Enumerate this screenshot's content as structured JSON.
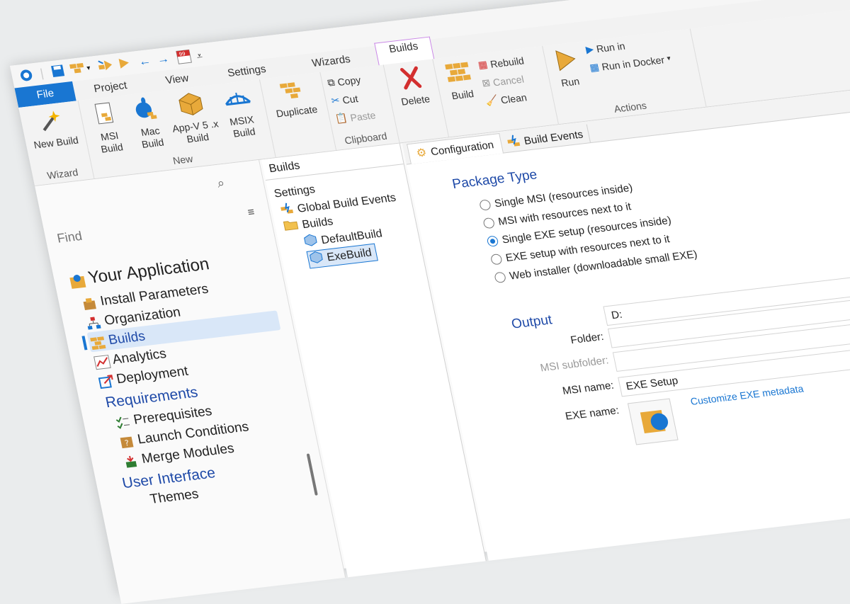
{
  "quick_access": {
    "icons": [
      "app-logo-icon",
      "save-icon",
      "build-bricks-icon",
      "dropdown-icon",
      "build-run-icon",
      "run-arrow-icon",
      "back-arrow-icon",
      "forward-arrow-icon",
      "tasks-icon",
      "more-icon"
    ],
    "badge": "99"
  },
  "tabs": {
    "file": "File",
    "project": "Project",
    "view": "View",
    "settings": "Settings",
    "wizards": "Wizards",
    "builds": "Builds"
  },
  "ribbon": {
    "wizard_group": {
      "label": "Wizard",
      "new_build": "New Build"
    },
    "new_group": {
      "label": "New",
      "msi_build": "MSI Build",
      "mac_build": "Mac Build",
      "appv_build": "App-V 5 .x Build",
      "msix_build": "MSIX Build"
    },
    "duplicate": "Duplicate",
    "clipboard_group": {
      "label": "Clipboard",
      "copy": "Copy",
      "cut": "Cut",
      "paste": "Paste"
    },
    "delete": "Delete",
    "build_group": {
      "build": "Build",
      "rebuild": "Rebuild",
      "cancel": "Cancel",
      "clean": "Clean"
    },
    "actions_group": {
      "label": "Actions",
      "run": "Run",
      "run_in": "Run in",
      "run_in_docker": "Run in Docker"
    }
  },
  "left_pane": {
    "search_placeholder": "Find",
    "app_title": "Your Application",
    "items": [
      "Install Parameters",
      "Organization",
      "Builds",
      "Analytics",
      "Deployment"
    ],
    "requirements_title": "Requirements",
    "requirements_items": [
      "Prerequisites",
      "Launch Conditions",
      "Merge Modules"
    ],
    "ui_title": "User Interface",
    "ui_partial": "Themes"
  },
  "mid_pane": {
    "header": "Builds",
    "settings_label": "Settings",
    "global_build_events": "Global Build Events",
    "builds_folder": "Builds",
    "default_build": "DefaultBuild",
    "exe_build": "ExeBuild"
  },
  "right_pane": {
    "tabs": {
      "configuration": "Configuration",
      "build_events": "Build Events"
    },
    "package_type": {
      "title": "Package Type",
      "options": [
        "Single MSI (resources inside)",
        "MSI with resources next to it",
        "Single EXE setup (resources inside)",
        "EXE setup with resources next to it",
        "Web installer (downloadable small EXE)"
      ],
      "selected_index": 2
    },
    "output": {
      "title": "Output",
      "folder_label": "Folder:",
      "folder_value": "D:",
      "msi_subfolder_label": "MSI subfolder:",
      "msi_subfolder_value": "",
      "msi_name_label": "MSI name:",
      "msi_name_value": "",
      "exe_name_label": "EXE name:",
      "exe_name_value": "EXE Setup",
      "customize_link": "Customize EXE metadata"
    }
  },
  "colors": {
    "accent": "#1976d2",
    "heading_blue": "#1f4aa8",
    "build_tab_border": "#c987e6",
    "brick": "#e8a93a"
  }
}
